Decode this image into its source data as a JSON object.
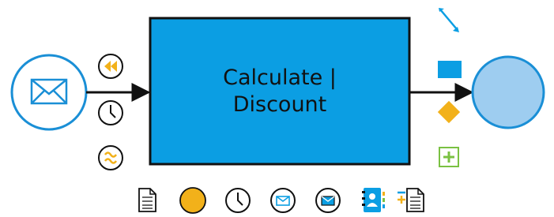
{
  "task": {
    "label_line1": "Calculate |",
    "label_line2": "Discount"
  },
  "colors": {
    "task_fill": "#0b9ee3",
    "event_stroke": "#1a8fd6",
    "end_fill": "#9ecdf0",
    "gold": "#f2b11a",
    "green": "#7ac142",
    "flow": "#111111"
  },
  "icons": {
    "start_event": "envelope-icon",
    "boundary": [
      "rewind-icon",
      "clock-icon",
      "signal-wave-icon"
    ],
    "palette_right": [
      "connector-arrow-icon",
      "rectangle-task-icon",
      "gateway-diamond-icon",
      "add-icon"
    ],
    "palette_bottom": [
      "document-icon",
      "circle-event-icon",
      "clock-icon",
      "envelope-circle-icon",
      "envelope-filled-circle-icon",
      "contacts-icon",
      "add-document-icon"
    ]
  }
}
